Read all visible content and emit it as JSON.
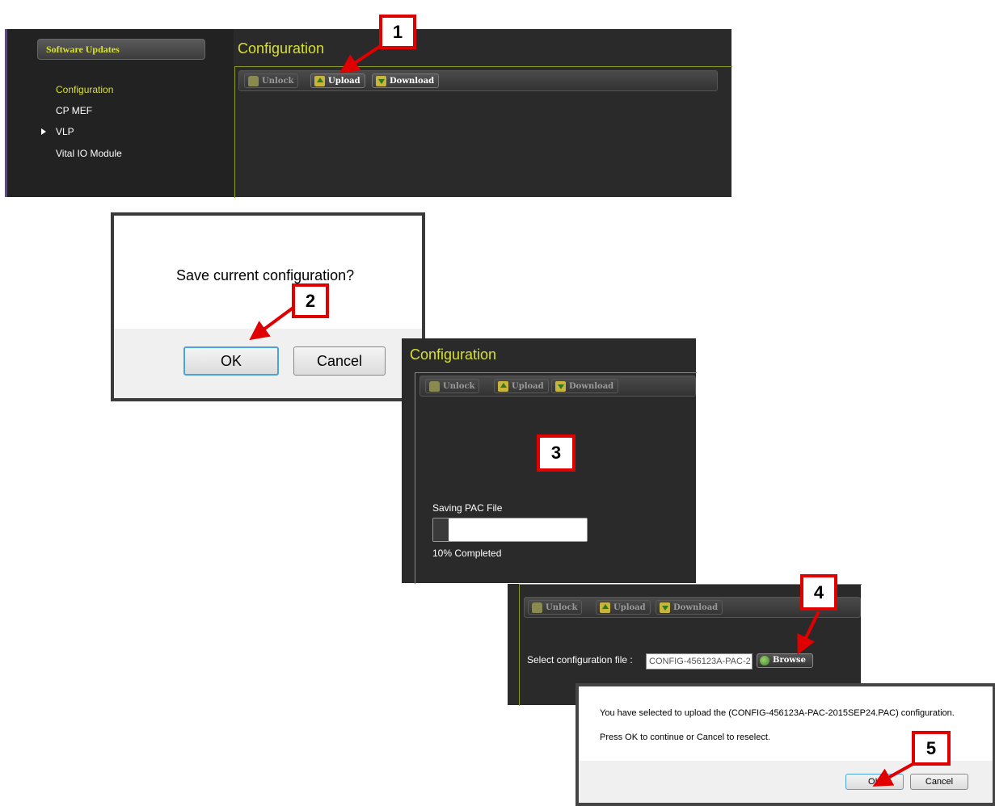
{
  "panel1": {
    "sidebar_header": "Software Updates",
    "sidebar_items": [
      {
        "label": "Configuration",
        "active": true
      },
      {
        "label": "CP MEF"
      },
      {
        "label": "VLP",
        "expandable": true
      },
      {
        "label": "Vital IO Module"
      }
    ],
    "title": "Configuration",
    "toolbar": {
      "unlock": "Unlock",
      "upload": "Upload",
      "download": "Download"
    }
  },
  "dialog_save": {
    "message": "Save current configuration?",
    "ok": "OK",
    "cancel": "Cancel"
  },
  "panel3": {
    "title": "Configuration",
    "toolbar": {
      "unlock": "Unlock",
      "upload": "Upload",
      "download": "Download"
    },
    "progress_label": "Saving PAC File",
    "progress_value": 0.1,
    "progress_text": "10% Completed"
  },
  "panel4": {
    "toolbar": {
      "unlock": "Unlock",
      "upload": "Upload",
      "download": "Download"
    },
    "select_label": "Select configuration file :",
    "file_value": "CONFIG-456123A-PAC-2",
    "browse": "Browse"
  },
  "dialog_confirm": {
    "line1": "You have selected to upload the (CONFIG-456123A-PAC-2015SEP24.PAC) configuration.",
    "line2": "Press OK to continue or Cancel to reselect.",
    "ok": "OK",
    "cancel": "Cancel"
  },
  "badges": [
    "1",
    "2",
    "3",
    "4",
    "5"
  ],
  "colors": {
    "accent_yellow": "#d8e030",
    "panel_bg": "#2a2a2a",
    "annotation_red": "#e00000"
  }
}
